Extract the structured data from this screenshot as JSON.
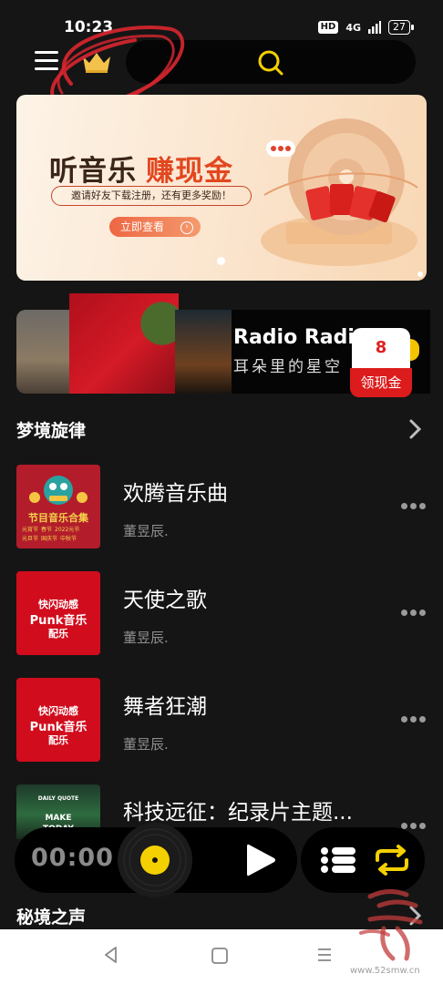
{
  "status_bar": {
    "time": "10:23",
    "hd": "HD",
    "network": "4G",
    "battery": "27"
  },
  "banner": {
    "title_part1": "听音乐",
    "title_part2": "赚现金",
    "subtitle": "邀请好友下载注册，还有更多奖励！",
    "cta": "立即查看",
    "active_page": 1
  },
  "radio_card": {
    "title": "Radio Radio",
    "subtitle": "耳朵里的星空",
    "reward_count": "8",
    "reward_label": "领现金"
  },
  "section1": {
    "title": "梦境旋律"
  },
  "songs": [
    {
      "title": "欢腾音乐曲",
      "artist": "董昱辰.",
      "cover_line1": "节目音乐合集",
      "cover_tags": [
        "元宵节",
        "春节",
        "2022元节",
        "元旦节",
        "国庆节",
        "中秋节"
      ]
    },
    {
      "title": "天使之歌",
      "artist": "董昱辰.",
      "cover_line1": "快闪动感",
      "cover_line2": "Punk音乐",
      "cover_line3": "配乐"
    },
    {
      "title": "舞者狂潮",
      "artist": "董昱辰.",
      "cover_line1": "快闪动感",
      "cover_line2": "Punk音乐",
      "cover_line3": "配乐"
    },
    {
      "title": "科技远征：纪录片主题...",
      "artist": "",
      "cover_line1": "DAILY QUOTE",
      "cover_line2": "MAKE",
      "cover_line3": "TODAY"
    }
  ],
  "player": {
    "time": "00:00",
    "accent": "#f5d000"
  },
  "section2": {
    "title": "秘境之声"
  },
  "watermark": {
    "url": "www.52smw.cn"
  },
  "colors": {
    "accent_yellow": "#f5d000",
    "reward_red": "#dc1c1c",
    "background": "#151515"
  },
  "icons": [
    "menu-icon",
    "crown-icon",
    "search-icon",
    "chevron-right-icon",
    "more-icon",
    "vinyl-icon",
    "play-icon",
    "playlist-icon",
    "loop-icon",
    "nav-back-icon",
    "nav-home-icon",
    "nav-recent-icon"
  ]
}
